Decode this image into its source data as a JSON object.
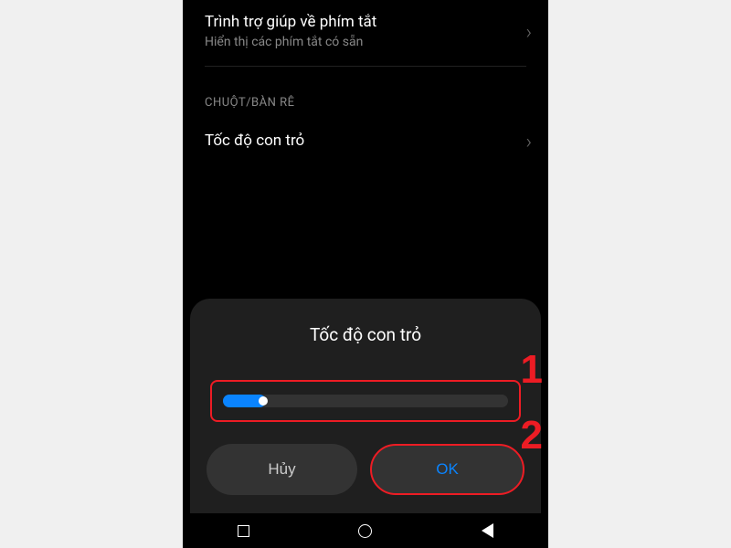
{
  "settings": {
    "shortcut_helper": {
      "title": "Trình trợ giúp về phím tắt",
      "subtitle": "Hiển thị các phím tắt có sẵn"
    },
    "section_mouse": "CHUỘT/BÀN RÊ",
    "pointer_speed": {
      "title": "Tốc độ con trỏ"
    }
  },
  "dialog": {
    "title": "Tốc độ con trỏ",
    "slider_value": 15,
    "cancel": "Hủy",
    "ok": "OK"
  },
  "annotations": {
    "one": "1",
    "two": "2"
  }
}
